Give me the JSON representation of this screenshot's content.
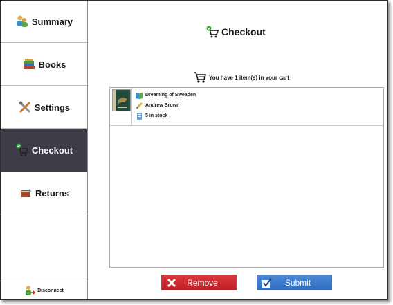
{
  "sidebar": {
    "items": [
      {
        "label": "Summary",
        "icon": "users-icon"
      },
      {
        "label": "Books",
        "icon": "books-icon"
      },
      {
        "label": "Settings",
        "icon": "tools-icon"
      },
      {
        "label": "Checkout",
        "icon": "cart-check-icon",
        "active": true
      },
      {
        "label": "Returns",
        "icon": "book-return-icon"
      }
    ],
    "disconnect_label": "Disconnect"
  },
  "main": {
    "title": "Checkout",
    "cart_info": "You have 1 item(s) in your cart",
    "items": [
      {
        "title": "Dreaming of Sweaden",
        "author": "Andrew Brown",
        "stock": "5 in stock"
      }
    ]
  },
  "buttons": {
    "remove_label": "Remove",
    "submit_label": "Submit"
  },
  "colors": {
    "active_nav": "#3e3d47",
    "remove": "#c01f25",
    "submit": "#2f6ec0"
  }
}
